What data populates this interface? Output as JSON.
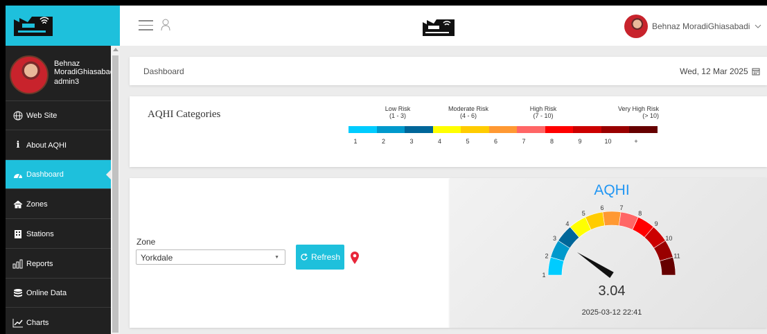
{
  "sidebar": {
    "user_name": "Behnaz MoradiGhiasabadi",
    "user_role": "admin3",
    "items": [
      {
        "label": "Web Site",
        "icon": "globe-icon"
      },
      {
        "label": "About AQHI",
        "icon": "info-icon"
      },
      {
        "label": "Dashboard",
        "icon": "dashboard-icon",
        "active": true
      },
      {
        "label": "Zones",
        "icon": "home-icon"
      },
      {
        "label": "Stations",
        "icon": "building-icon"
      },
      {
        "label": "Reports",
        "icon": "bar-chart-icon"
      },
      {
        "label": "Online Data",
        "icon": "database-icon"
      },
      {
        "label": "Charts",
        "icon": "line-chart-icon"
      }
    ]
  },
  "topbar": {
    "user_name": "Behnaz MoradiGhiasabadi"
  },
  "breadcrumb": {
    "title": "Dashboard",
    "date": "Wed, 12 Mar 2025"
  },
  "categories": {
    "title": "AQHI Categories",
    "risks": [
      {
        "label": "Low Risk",
        "range": "(1 - 3)"
      },
      {
        "label": "Moderate Risk",
        "range": "(4 - 6)"
      },
      {
        "label": "High Risk",
        "range": "(7 - 10)"
      },
      {
        "label": "Very High Risk",
        "range": "(> 10)"
      }
    ],
    "scale": [
      {
        "n": "1",
        "color": "#00ccff"
      },
      {
        "n": "2",
        "color": "#0099cc"
      },
      {
        "n": "3",
        "color": "#006699"
      },
      {
        "n": "4",
        "color": "#ffff00"
      },
      {
        "n": "5",
        "color": "#ffcc00"
      },
      {
        "n": "6",
        "color": "#ff9933"
      },
      {
        "n": "7",
        "color": "#ff6666"
      },
      {
        "n": "8",
        "color": "#ff0000"
      },
      {
        "n": "9",
        "color": "#cc0000"
      },
      {
        "n": "10",
        "color": "#990000"
      },
      {
        "n": "+",
        "color": "#660000"
      }
    ]
  },
  "zone": {
    "label": "Zone",
    "selected": "Yorkdale",
    "refresh_label": "Refresh"
  },
  "gauge": {
    "title": "AQHI",
    "value": "3.04",
    "value_num": 3.04,
    "timestamp": "2025-03-12 22:41",
    "ticks": [
      "1",
      "2",
      "3",
      "4",
      "5",
      "6",
      "7",
      "8",
      "9",
      "10",
      "11"
    ]
  }
}
